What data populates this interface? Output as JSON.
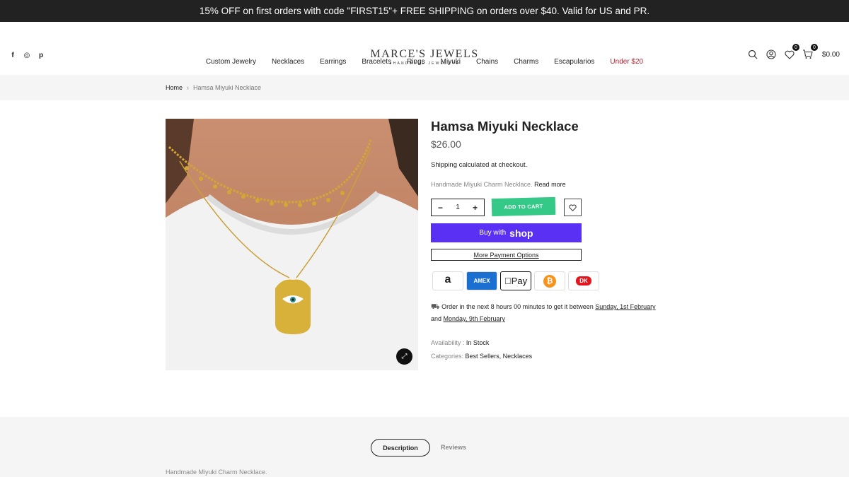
{
  "announcement": "15% OFF on first orders with code \"FIRST15\"+ FREE SHIPPING on orders over $40. Valid for US and PR.",
  "social": {
    "facebook": "f",
    "instagram": "◎",
    "pinterest": "p"
  },
  "brand": {
    "name": "MARCE'S JEWELS",
    "tagline": "●HANDMADE JEWELRY●"
  },
  "header": {
    "wishlist_count": "0",
    "cart_count": "0",
    "cart_total": "$0.00"
  },
  "nav": [
    "Custom Jewelry",
    "Necklaces",
    "Earrings",
    "Bracelets",
    "Rings",
    "Miyuki",
    "Chains",
    "Charms",
    "Escapularios",
    "Under $20"
  ],
  "breadcrumb": {
    "home": "Home",
    "separator": "›",
    "current": "Hamsa Miyuki Necklace"
  },
  "product": {
    "title": "Hamsa Miyuki Necklace",
    "price": "$26.00",
    "shipping": "Shipping calculated at checkout.",
    "short_desc": "Handmade Miyuki Charm Necklace.",
    "read_more": "Read more",
    "quantity": "1",
    "minus": "−",
    "plus": "+",
    "add_to_cart": "ADD TO CART",
    "buy_with": "Buy with",
    "shop_word": "shop",
    "more_payment": "More Payment Options",
    "delivery_prefix": "Order in the next 8 hours 00 minutes to get it between",
    "delivery_start": "Sunday, 1st February",
    "delivery_and": "and",
    "delivery_end": "Monday, 9th February",
    "availability_label": "Availability :",
    "availability_value": "In Stock",
    "categories_label": "Categories:",
    "category_1": "Best Sellers",
    "category_sep": ",",
    "category_2": "Necklaces"
  },
  "payment_icons": [
    "amazon-pay-icon",
    "amex-icon",
    "apple-pay-icon",
    "bitcoin-icon",
    "dankort-icon"
  ],
  "payment_text": {
    "amazon": "a",
    "amex": "AMEX",
    "apple": "Pay",
    "bitcoin": "₿",
    "dankort": "DK"
  },
  "tabs": {
    "description": "Description",
    "reviews": "Reviews"
  },
  "description_text": "Handmade Miyuki Charm Necklace.",
  "colors": {
    "accent_green": "#35c987",
    "shop_purple": "#5a31f4",
    "sale_red": "#b3202c",
    "amex_blue": "#1b6fd1",
    "bitcoin_orange": "#f7931a",
    "dankort_red": "#e2161e"
  }
}
